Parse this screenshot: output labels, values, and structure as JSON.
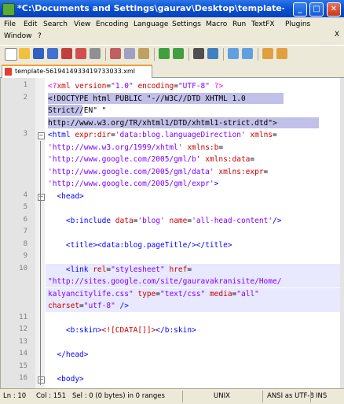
{
  "window": {
    "title": "*C:\\Documents and Settings\\gaurav\\Desktop\\template-56194149..."
  },
  "menu": [
    "File",
    "Edit",
    "Search",
    "View",
    "Encoding",
    "Language",
    "Settings",
    "Macro",
    "Run",
    "TextFX",
    "Plugins",
    "Window",
    "?"
  ],
  "menu_close": "X",
  "tab": {
    "label": "template-5619414933419733033.xml"
  },
  "lines": [
    {
      "n": "1",
      "segs": [
        [
          "<?",
          "pink"
        ],
        [
          "xml ",
          "red"
        ],
        [
          "version",
          "red"
        ],
        [
          "=",
          "black"
        ],
        [
          "\"1.0\" ",
          "purple"
        ],
        [
          "encoding",
          "red"
        ],
        [
          "=",
          "black"
        ],
        [
          "\"UTF-8\" ",
          "purple"
        ],
        [
          "?>",
          "pink"
        ]
      ]
    },
    {
      "n": "2",
      "segs": [
        [
          "<!DOCTYPE html PUBLIC \"-//W3C//DTD XHTML 1.0",
          "black"
        ]
      ]
    },
    {
      "n": "",
      "segs": [
        [
          "Strict//EN\" \"",
          "black"
        ]
      ]
    },
    {
      "n": "",
      "segs": [
        [
          "http://www.w3.org/TR/xhtml1/DTD/xhtml1-strict.dtd\">",
          "black"
        ]
      ]
    },
    {
      "n": "3",
      "segs": [
        [
          "<html ",
          "blue"
        ],
        [
          "expr:dir",
          "red"
        ],
        [
          "=",
          "black"
        ],
        [
          "'data:blog.languageDirection' ",
          "purple"
        ],
        [
          "xmlns",
          "red"
        ],
        [
          "=",
          "black"
        ]
      ]
    },
    {
      "n": "",
      "segs": [
        [
          "'http://www.w3.org/1999/xhtml' ",
          "purple"
        ],
        [
          "xmlns:b",
          "red"
        ],
        [
          "=",
          "black"
        ]
      ]
    },
    {
      "n": "",
      "segs": [
        [
          "'http://www.google.com/2005/gml/b' ",
          "purple"
        ],
        [
          "xmlns:data",
          "red"
        ],
        [
          "=",
          "black"
        ]
      ]
    },
    {
      "n": "",
      "segs": [
        [
          "'http://www.google.com/2005/gml/data' ",
          "purple"
        ],
        [
          "xmlns:expr",
          "red"
        ],
        [
          "=",
          "black"
        ]
      ]
    },
    {
      "n": "",
      "segs": [
        [
          "'http://www.google.com/2005/gml/expr'",
          "purple"
        ],
        [
          ">",
          "blue"
        ]
      ]
    },
    {
      "n": "4",
      "segs": [
        [
          "  <head>",
          "blue"
        ]
      ]
    },
    {
      "n": "5",
      "segs": [
        [
          "",
          "black"
        ]
      ]
    },
    {
      "n": "6",
      "segs": [
        [
          "    <b:include ",
          "blue"
        ],
        [
          "data",
          "red"
        ],
        [
          "=",
          "black"
        ],
        [
          "'blog' ",
          "purple"
        ],
        [
          "name",
          "red"
        ],
        [
          "=",
          "black"
        ],
        [
          "'all-head-content'",
          "purple"
        ],
        [
          "/>",
          "blue"
        ]
      ]
    },
    {
      "n": "7",
      "segs": [
        [
          "",
          "black"
        ]
      ]
    },
    {
      "n": "8",
      "segs": [
        [
          "    <title>",
          "blue"
        ],
        [
          "<data:blog.pageTitle/>",
          "blue"
        ],
        [
          "</title>",
          "blue"
        ]
      ]
    },
    {
      "n": "9",
      "segs": [
        [
          "",
          "black"
        ]
      ]
    },
    {
      "n": "10",
      "segs": [
        [
          "    <link ",
          "blue"
        ],
        [
          "rel",
          "red"
        ],
        [
          "=",
          "black"
        ],
        [
          "\"stylesheet\" ",
          "purple"
        ],
        [
          "href",
          "red"
        ],
        [
          "=",
          "black"
        ]
      ]
    },
    {
      "n": "",
      "segs": [
        [
          "\"http://sites.google.com/site/gauravakranisite/Home/",
          "purple"
        ]
      ]
    },
    {
      "n": "",
      "segs": [
        [
          "kalyancitylife.css\" ",
          "purple"
        ],
        [
          "type",
          "red"
        ],
        [
          "=",
          "black"
        ],
        [
          "\"text/css\" ",
          "purple"
        ],
        [
          "media",
          "red"
        ],
        [
          "=",
          "black"
        ],
        [
          "\"all\"",
          "purple"
        ]
      ]
    },
    {
      "n": "",
      "segs": [
        [
          "charset",
          "red"
        ],
        [
          "=",
          "black"
        ],
        [
          "\"utf-8\" ",
          "purple"
        ],
        [
          "/>",
          "blue"
        ]
      ]
    },
    {
      "n": "11",
      "segs": [
        [
          "",
          "black"
        ]
      ]
    },
    {
      "n": "12",
      "segs": [
        [
          "    <b:skin>",
          "blue"
        ],
        [
          "<![CDATA[]]>",
          "red"
        ],
        [
          "</b:skin>",
          "blue"
        ]
      ]
    },
    {
      "n": "13",
      "segs": [
        [
          "",
          "black"
        ]
      ]
    },
    {
      "n": "14",
      "segs": [
        [
          "  </head>",
          "blue"
        ]
      ]
    },
    {
      "n": "15",
      "segs": [
        [
          "",
          "black"
        ]
      ]
    },
    {
      "n": "16",
      "segs": [
        [
          "  <body>",
          "blue"
        ]
      ]
    }
  ],
  "status": {
    "ln": "Ln : 10",
    "col": "Col : 151",
    "sel": "Sel : 0 (0 bytes) in 0 ranges",
    "eol": "UNIX",
    "enc": "ANSI as UTF-8",
    "ins": "INS"
  },
  "colors": {
    "red": "#c80000",
    "blue": "#0000ff",
    "purple": "#8000ff",
    "pink": "#ff00ff",
    "black": "#000000"
  }
}
